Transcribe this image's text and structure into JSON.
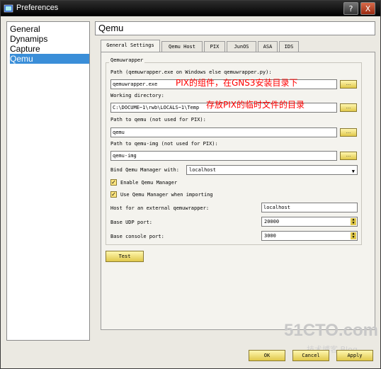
{
  "window": {
    "title": "Preferences",
    "help": "?",
    "close": "X"
  },
  "nav": {
    "items": [
      "General",
      "Dynamips",
      "Capture",
      "Qemu"
    ],
    "selected": "Qemu"
  },
  "header": "Qemu",
  "tabs": [
    "General Settings",
    "Qemu Host",
    "PIX",
    "JunOS",
    "ASA",
    "IDS"
  ],
  "group_title": "Qemuwrapper",
  "path_label": "Path (qemuwrapper.exe on Windows else qemuwrapper.py):",
  "path_value": "qemuwrapper.exe",
  "path_annotation": "PIX的组件，在GNS3安装目录下",
  "workdir_label": "Working directory:",
  "workdir_value": "C:\\DOCUME~1\\rwb\\LOCALS~1\\Temp",
  "workdir_annotation": "存放PIX的临时文件的目录",
  "qemu_label": "Path to qemu (not used for PIX):",
  "qemu_value": "qemu",
  "qemuimg_label": "Path to qemu-img (not used for PIX):",
  "qemuimg_value": "qemu-img",
  "bind_label": "Bind Qemu Manager with:",
  "bind_value": "localhost",
  "enable_manager_label": "Enable Qemu Manager",
  "use_manager_label": "Use Qemu Manager when importing",
  "host_label": "Host for an external qemuwrapper:",
  "host_value": "localhost",
  "udp_label": "Base UDP port:",
  "udp_value": "20000",
  "console_label": "Base console port:",
  "console_value": "3000",
  "browse_label": "...",
  "test_label": "Test",
  "ok_label": "OK",
  "cancel_label": "Cancel",
  "apply_label": "Apply",
  "watermark": "51CTO.com",
  "watermark_sub": "技术博客  Blog",
  "colors": {
    "selection": "#3a8ed8",
    "annotation": "#ff0000",
    "button": "#e0c84a"
  }
}
